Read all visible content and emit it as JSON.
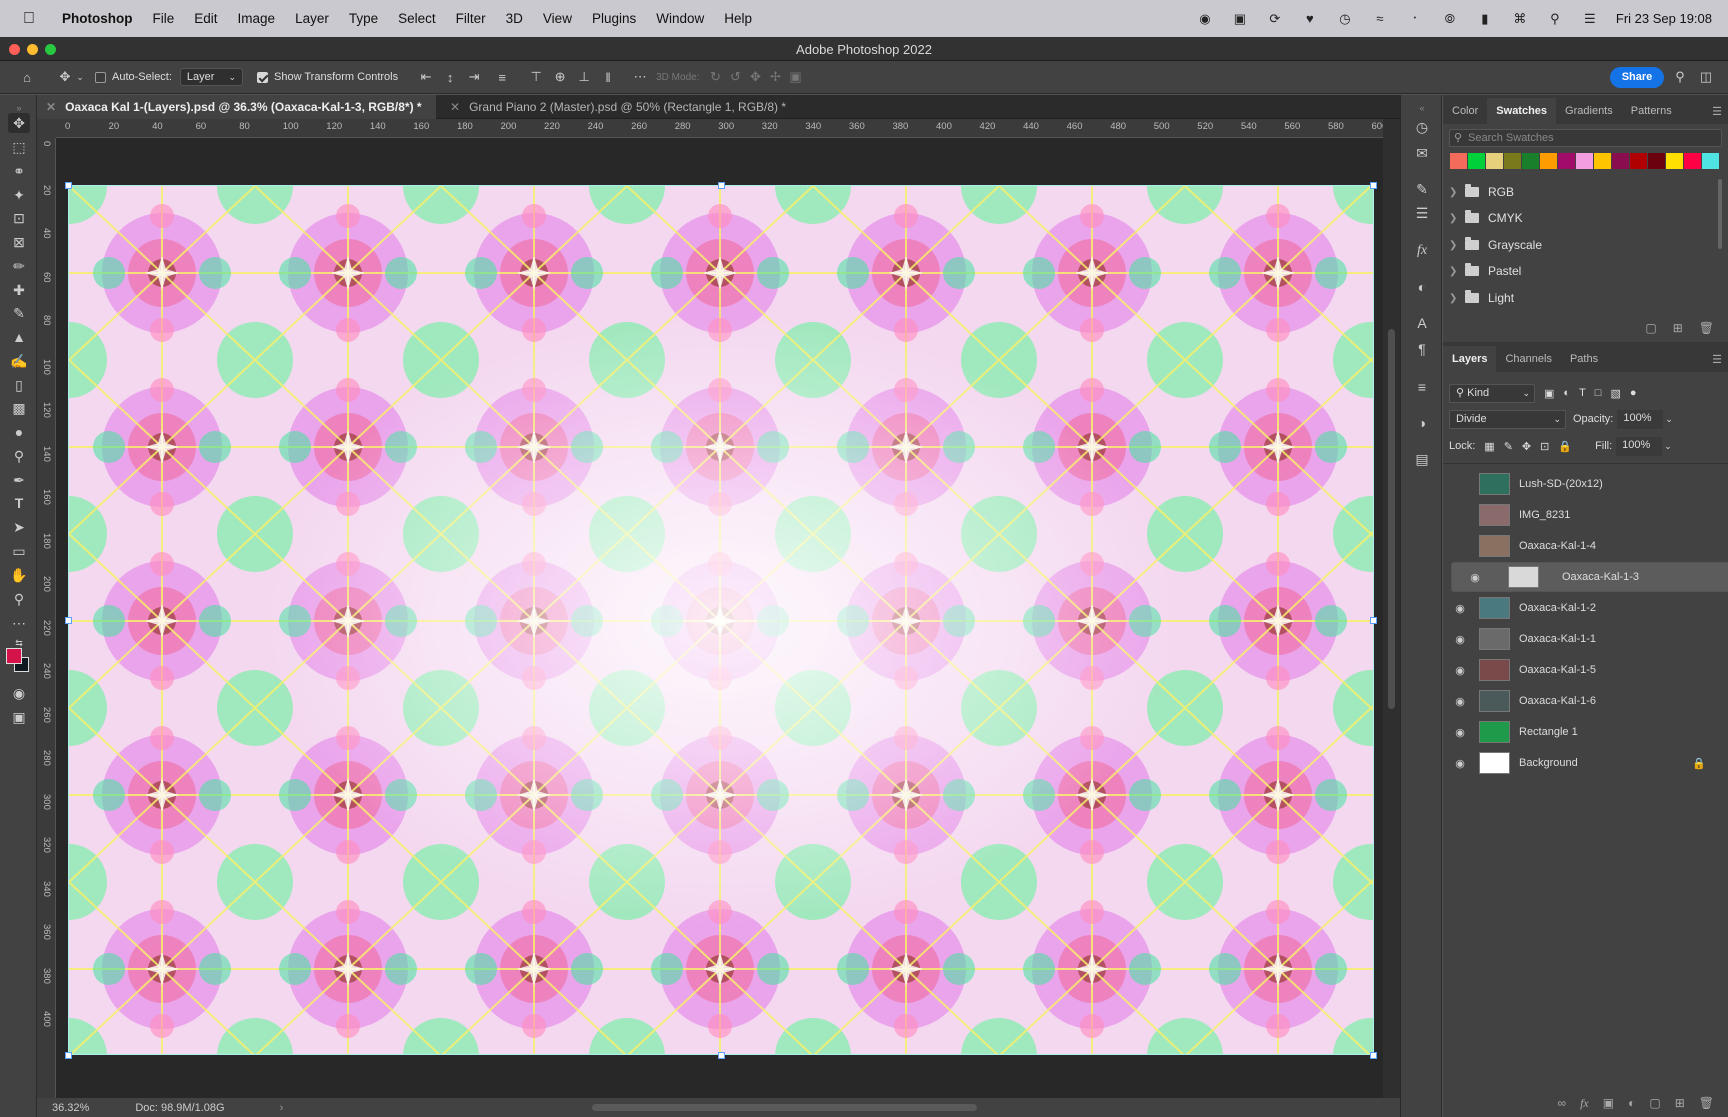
{
  "menubar": {
    "app_name": "Photoshop",
    "items": [
      "File",
      "Edit",
      "Image",
      "Layer",
      "Type",
      "Select",
      "Filter",
      "3D",
      "View",
      "Plugins",
      "Window",
      "Help"
    ],
    "datetime": "Fri 23 Sep  19:08"
  },
  "window": {
    "title": "Adobe Photoshop 2022"
  },
  "options": {
    "auto_select_label": "Auto-Select:",
    "auto_select_value": "Layer",
    "show_transform_label": "Show Transform Controls",
    "mode_3d_label": "3D Mode:",
    "share_label": "Share"
  },
  "tabs": [
    {
      "title": "Oaxaca Kal 1-(Layers).psd @ 36.3% (Oaxaca-Kal-1-3, RGB/8*) *"
    },
    {
      "title": "Grand Piano 2 (Master).psd @ 50% (Rectangle 1, RGB/8) *"
    }
  ],
  "ruler": {
    "h_ticks": [
      "0",
      "20",
      "40",
      "60",
      "80",
      "100",
      "120",
      "140",
      "160",
      "180",
      "200",
      "220",
      "240",
      "260",
      "280",
      "300",
      "320",
      "340",
      "360",
      "380",
      "400",
      "420",
      "440",
      "460",
      "480",
      "500",
      "520",
      "540",
      "560",
      "580",
      "600"
    ],
    "v_ticks": [
      "0",
      "20",
      "40",
      "60",
      "80",
      "100",
      "120",
      "140",
      "160",
      "180",
      "200",
      "220",
      "240",
      "260",
      "280",
      "300",
      "320",
      "340",
      "360",
      "380",
      "400"
    ]
  },
  "status": {
    "zoom": "36.32%",
    "doc": "Doc: 98.9M/1.08G"
  },
  "swatches_panel": {
    "tabs": [
      "Color",
      "Swatches",
      "Gradients",
      "Patterns"
    ],
    "active_tab": "Swatches",
    "search_placeholder": "Search Swatches",
    "colors": [
      "#f26b5b",
      "#00d03a",
      "#e7d07c",
      "#7a7a1d",
      "#1a7f2a",
      "#ff9c00",
      "#a10c6a",
      "#f39ee0",
      "#ffc400",
      "#8a0d4f",
      "#b10000",
      "#6b000f",
      "#ffe000",
      "#ff0045",
      "#4fe3e3"
    ],
    "groups": [
      "RGB",
      "CMYK",
      "Grayscale",
      "Pastel",
      "Light"
    ]
  },
  "layers_panel": {
    "tabs": [
      "Layers",
      "Channels",
      "Paths"
    ],
    "active_tab": "Layers",
    "kind_label": "Kind",
    "blend_mode": "Divide",
    "opacity_label": "Opacity:",
    "opacity_value": "100%",
    "lock_label": "Lock:",
    "fill_label": "Fill:",
    "fill_value": "100%",
    "layers": [
      {
        "name": "Lush-SD-(20x12)",
        "visible": false,
        "selected": false,
        "thumb": "#2e6f5e"
      },
      {
        "name": "IMG_8231",
        "visible": false,
        "selected": false,
        "thumb": "#8a6a6a"
      },
      {
        "name": "Oaxaca-Kal-1-4",
        "visible": false,
        "selected": false,
        "thumb": "#8a7060"
      },
      {
        "name": "Oaxaca-Kal-1-3",
        "visible": true,
        "selected": true,
        "thumb": "#d9d9d9"
      },
      {
        "name": "Oaxaca-Kal-1-2",
        "visible": true,
        "selected": false,
        "thumb": "#4a7a80"
      },
      {
        "name": "Oaxaca-Kal-1-1",
        "visible": true,
        "selected": false,
        "thumb": "#6a6a6a"
      },
      {
        "name": "Oaxaca-Kal-1-5",
        "visible": true,
        "selected": false,
        "thumb": "#7a4a4a"
      },
      {
        "name": "Oaxaca-Kal-1-6",
        "visible": true,
        "selected": false,
        "thumb": "#4a5a5a"
      },
      {
        "name": "Rectangle 1",
        "visible": true,
        "selected": false,
        "thumb": "#1e9a4a"
      },
      {
        "name": "Background",
        "visible": true,
        "selected": false,
        "thumb": "#ffffff",
        "locked": true
      }
    ]
  }
}
